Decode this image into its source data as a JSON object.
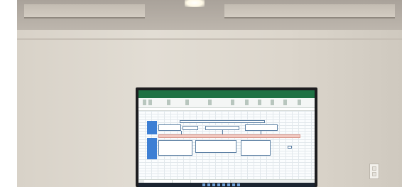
{
  "scene": {
    "subject": "wall-mounted-monitor",
    "palette": {
      "wall": "#dcd6cc",
      "ceiling": "#b3aca3",
      "bezel": "#1d1d1f",
      "excel_green": "#1f7244",
      "diagram_blue": "#3d7fd4",
      "band_pink": "#f1c9c1"
    }
  },
  "screen": {
    "app": "spreadsheet",
    "title_text": "",
    "icons": [
      "spreadsheet-ribbon-icon",
      "windows-taskbar-icon"
    ]
  }
}
